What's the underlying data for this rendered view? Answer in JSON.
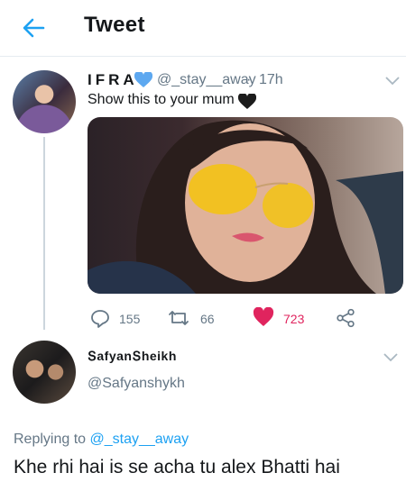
{
  "header": {
    "title": "Tweet",
    "back_icon": "back-arrow-icon"
  },
  "tweet": {
    "name": "IFRA",
    "handle": "@_stay__away",
    "separator": "·",
    "time": "17h",
    "text": "Show this to your mum",
    "image_alt": "selfie-photo",
    "actions": {
      "reply_count": "155",
      "retweet_count": "66",
      "like_count": "723"
    }
  },
  "reply": {
    "name": "ՏafyanՏheikh",
    "handle": "@Safyanshykh",
    "replying_label": "Replying to",
    "replying_to": "@_stay__away",
    "text": "Khe rhi hai is se acha tu alex Bhatti hai"
  },
  "colors": {
    "accent": "#1da1f2",
    "like": "#e0245e",
    "muted": "#657786",
    "verified_heart": "#5da8f0"
  }
}
